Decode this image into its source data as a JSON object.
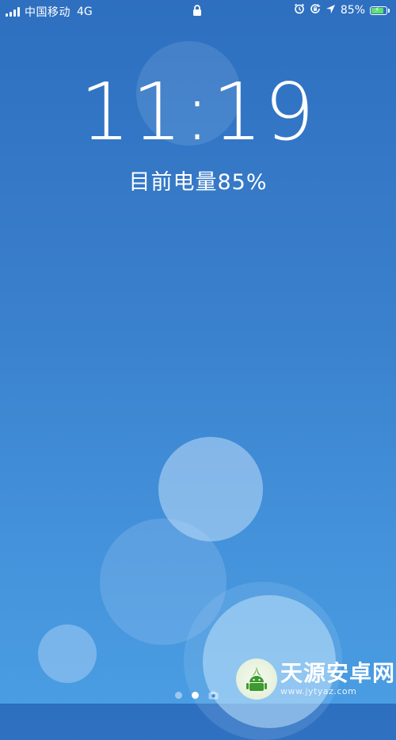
{
  "status_bar": {
    "carrier": "中国移动",
    "network": "4G",
    "battery_percent_label": "85%",
    "battery_level": 0.85,
    "icons": [
      "signal-icon",
      "lock-icon",
      "alarm-icon",
      "rotation-lock-icon",
      "location-icon",
      "battery-icon"
    ],
    "battery_color": "#5ee16a"
  },
  "lock_screen": {
    "time": "11:19",
    "battery_status": "目前电量85%"
  },
  "page_indicator": {
    "count": 3,
    "active_index": 1,
    "last_icon": "camera-icon"
  },
  "watermark": {
    "title": "天源安卓网",
    "url": "www.jytyaz.com"
  }
}
